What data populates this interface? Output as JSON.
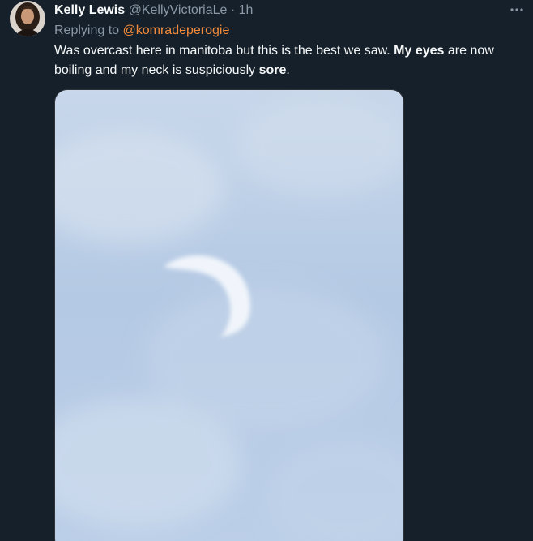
{
  "tweet": {
    "author_name": "Kelly Lewis",
    "author_handle": "@KellyVictoriaLe",
    "separator": "·",
    "timestamp": "1h",
    "replying_prefix": "Replying to",
    "replying_to": "@komradeperogie",
    "text_parts": {
      "p1": "Was overcast here in manitoba but this is the best we saw. ",
      "b1": "My eyes",
      "p2": " are now boiling and my neck is suspiciously ",
      "b2": "sore",
      "p3": "."
    },
    "more_icon": "more-horizontal-icon",
    "media": {
      "type": "photo",
      "subject": "partial solar eclipse crescent behind overcast clouds"
    }
  },
  "colors": {
    "background": "#15202b",
    "primary_text": "#f7f9f9",
    "secondary_text": "#8b98a5",
    "mention": "#f48b3a",
    "sky": "#b9cde6"
  }
}
